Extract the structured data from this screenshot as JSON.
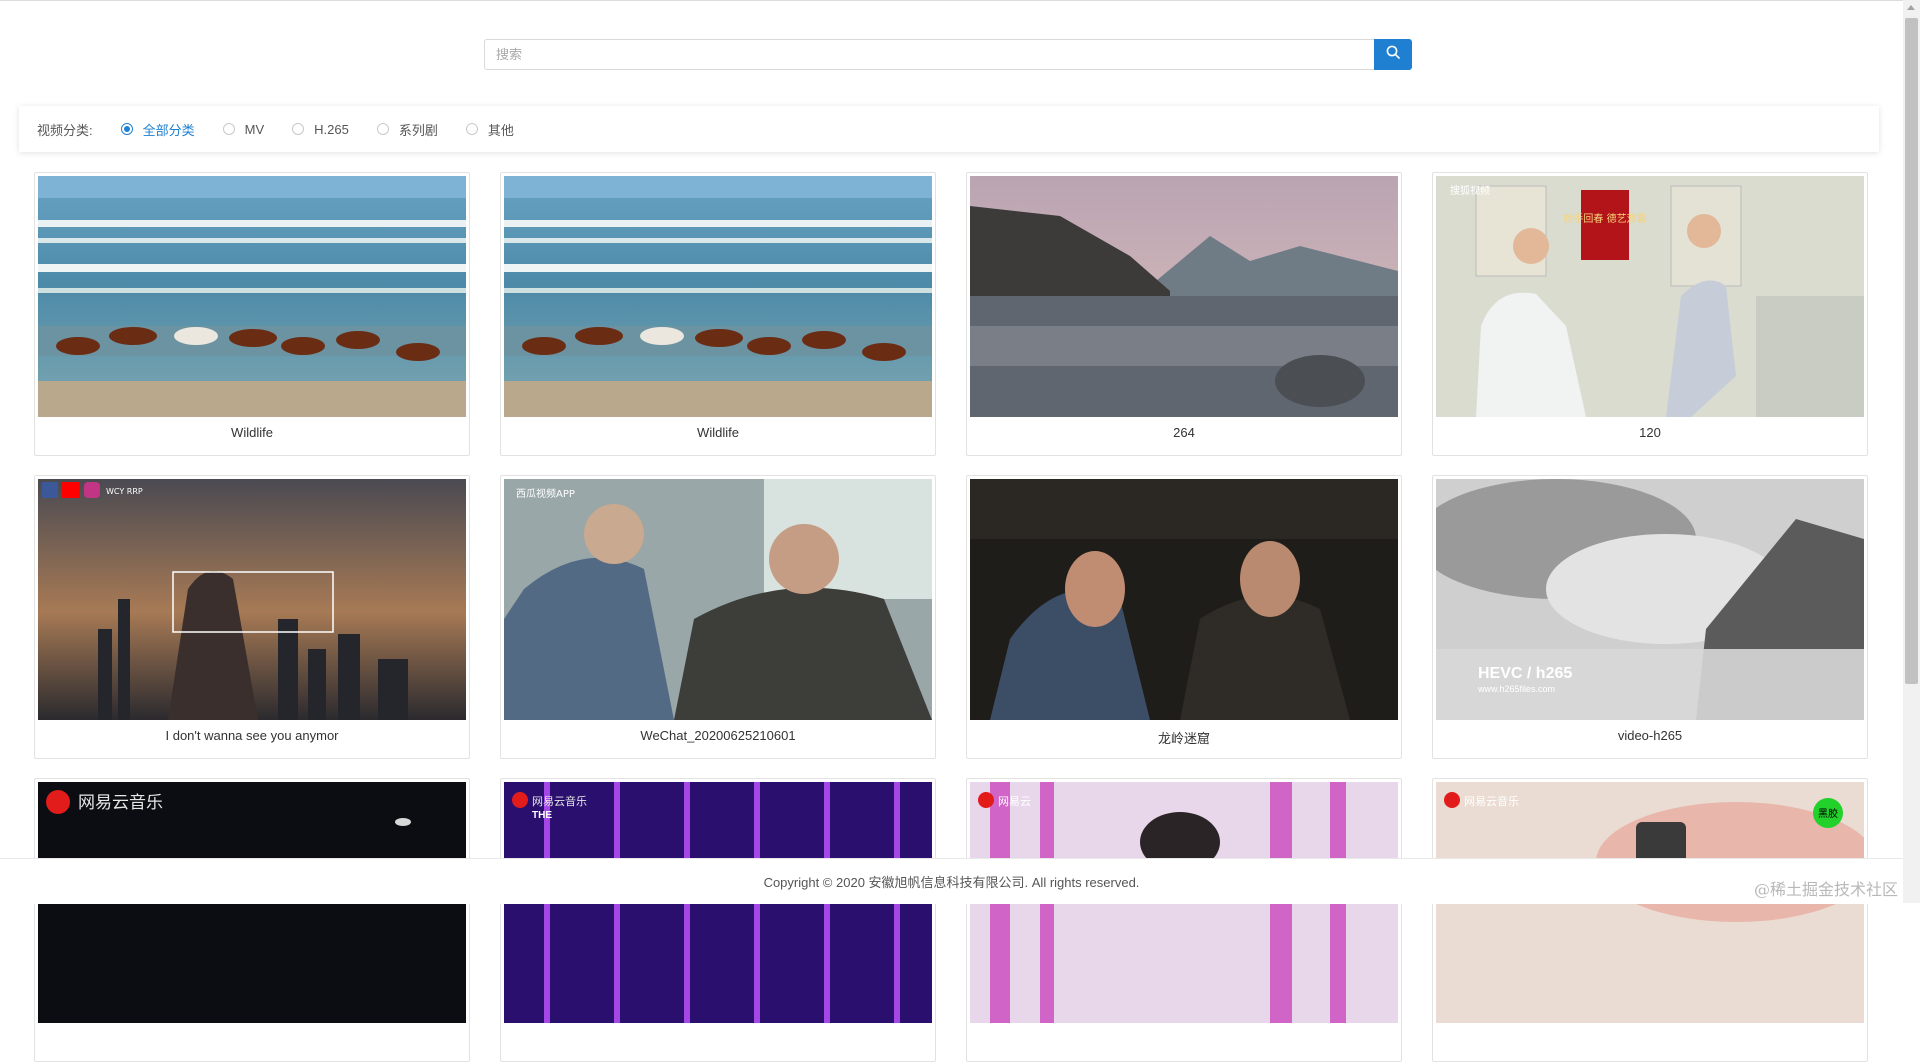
{
  "search": {
    "placeholder": "搜索",
    "value": ""
  },
  "filter": {
    "label": "视频分类:",
    "options": [
      {
        "label": "全部分类",
        "checked": true
      },
      {
        "label": "MV",
        "checked": false
      },
      {
        "label": "H.265",
        "checked": false
      },
      {
        "label": "系列剧",
        "checked": false
      },
      {
        "label": "其他",
        "checked": false
      }
    ]
  },
  "videos": [
    {
      "title": "Wildlife"
    },
    {
      "title": "Wildlife"
    },
    {
      "title": "264"
    },
    {
      "title": "120"
    },
    {
      "title": "I don't wanna see you anymor"
    },
    {
      "title": "WeChat_20200625210601"
    },
    {
      "title": "龙岭迷窟"
    },
    {
      "title": "video-h265"
    },
    {
      "title": "",
      "overlay_text": "网易云音乐"
    },
    {
      "title": "",
      "overlay_text": "网易云音乐"
    },
    {
      "title": "",
      "overlay_text": "网易云"
    },
    {
      "title": "",
      "overlay_text": "网易云音乐",
      "badge": "黑胶"
    }
  ],
  "thumb_text": {
    "v4_banner": "妙手回春 德艺双馨",
    "v4_corner": "搜狐视频",
    "v5_corner": "WCY RRP",
    "v6_corner": "西瓜视频APP",
    "v8_line1": "HEVC / h265",
    "v8_line2": "www.h265files.com",
    "v10_sub": "THE"
  },
  "footer": {
    "text": "Copyright © 2020 安徽旭帆信息科技有限公司. All rights reserved."
  },
  "watermark": "@稀土掘金技术社区",
  "colors": {
    "accent": "#1f7fd0",
    "netease_red": "#e21b1b"
  }
}
